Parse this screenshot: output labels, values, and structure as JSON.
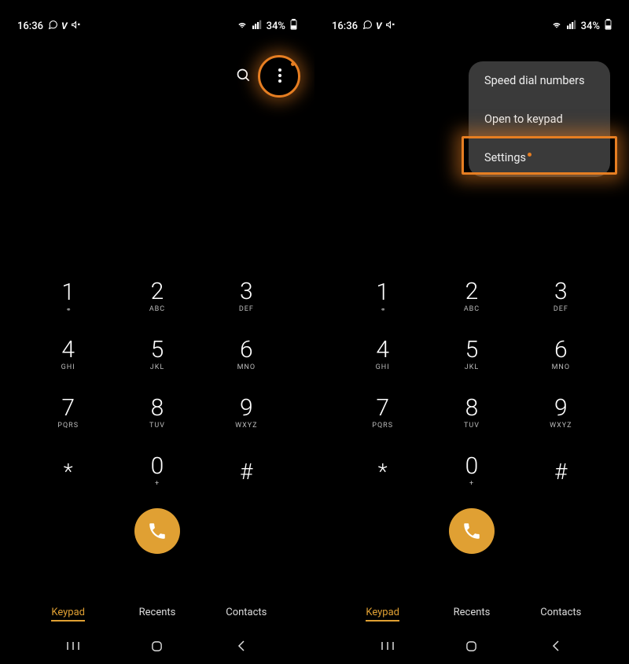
{
  "status": {
    "time": "16:36",
    "battery_text": "34%"
  },
  "keys": [
    {
      "d": "1",
      "s": "⚭"
    },
    {
      "d": "2",
      "s": "ABC"
    },
    {
      "d": "3",
      "s": "DEF"
    },
    {
      "d": "4",
      "s": "GHI"
    },
    {
      "d": "5",
      "s": "JKL"
    },
    {
      "d": "6",
      "s": "MNO"
    },
    {
      "d": "7",
      "s": "PQRS"
    },
    {
      "d": "8",
      "s": "TUV"
    },
    {
      "d": "9",
      "s": "WXYZ"
    },
    {
      "d": "*",
      "s": ""
    },
    {
      "d": "0",
      "s": "+"
    },
    {
      "d": "#",
      "s": ""
    }
  ],
  "tabs": {
    "keypad": "Keypad",
    "recents": "Recents",
    "contacts": "Contacts"
  },
  "menu": {
    "speed_dial": "Speed dial numbers",
    "open_keypad": "Open to keypad",
    "settings": "Settings"
  },
  "colors": {
    "accent": "#e0a033",
    "highlight": "#e67e22"
  }
}
